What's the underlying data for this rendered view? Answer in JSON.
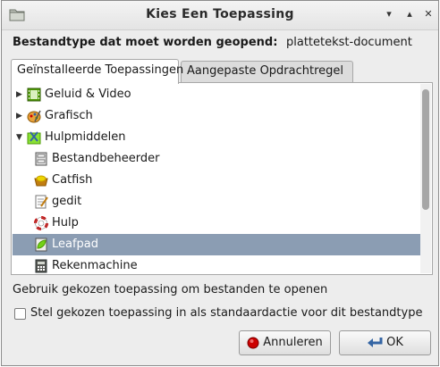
{
  "window": {
    "title": "Kies Een Toepassing",
    "controls": [
      "▾",
      "▴",
      "✕"
    ]
  },
  "filetype": {
    "label": "Bestandtype dat moet worden geopend:",
    "value": "plattetekst-document"
  },
  "tabs": [
    {
      "label": "Geïnstalleerde Toepassingen",
      "active": true
    },
    {
      "label": "Aangepaste Opdrachtregel",
      "active": false
    }
  ],
  "tree": {
    "items": [
      {
        "label": "Geluid & Video",
        "icon": "multimedia-icon",
        "level": 0,
        "expander": "▶",
        "selected": false
      },
      {
        "label": "Grafisch",
        "icon": "graphics-icon",
        "level": 0,
        "expander": "▶",
        "selected": false
      },
      {
        "label": "Hulpmiddelen",
        "icon": "accessories-icon",
        "level": 0,
        "expander": "▼",
        "selected": false
      },
      {
        "label": "Bestandbeheerder",
        "icon": "file-manager-icon",
        "level": 1,
        "expander": "",
        "selected": false
      },
      {
        "label": "Catfish",
        "icon": "catfish-icon",
        "level": 1,
        "expander": "",
        "selected": false
      },
      {
        "label": "gedit",
        "icon": "gedit-icon",
        "level": 1,
        "expander": "",
        "selected": false
      },
      {
        "label": "Hulp",
        "icon": "help-lifebuoy-icon",
        "level": 1,
        "expander": "",
        "selected": false
      },
      {
        "label": "Leafpad",
        "icon": "leafpad-icon",
        "level": 1,
        "expander": "",
        "selected": true
      },
      {
        "label": "Rekenmachine",
        "icon": "calculator-icon",
        "level": 1,
        "expander": "",
        "selected": false
      }
    ]
  },
  "hint": "Gebruik gekozen toepassing om bestanden te openen",
  "default_checkbox": {
    "label": "Stel gekozen toepassing in als standaardactie voor dit bestandtype",
    "checked": false
  },
  "buttons": {
    "cancel": "Annuleren",
    "ok": "OK"
  },
  "colors": {
    "selection": "#8b9db3",
    "window_bg": "#ededed"
  }
}
